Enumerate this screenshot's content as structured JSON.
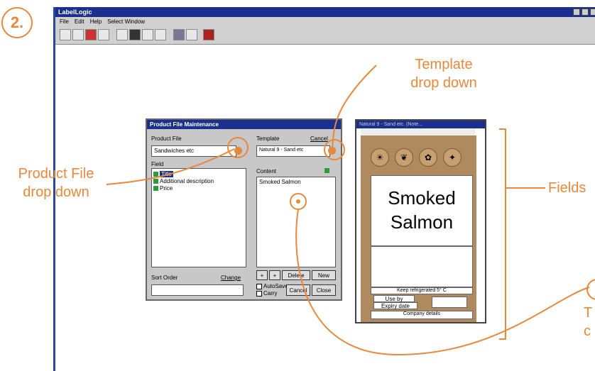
{
  "step_number": "2.",
  "app": {
    "title": "LabelLogic",
    "menu": [
      "File",
      "Edit",
      "Help",
      "Select Window"
    ]
  },
  "product_window": {
    "title": "Product File Maintenance",
    "product_file_label": "Product File",
    "product_file_value": "Sandwiches etc",
    "template_label": "Template",
    "template_value": "Natural 9 - Sand etc",
    "cancel_label": "Cancel",
    "field_label": "Field",
    "fields": [
      "Title",
      "Additional description",
      "Price"
    ],
    "content_label": "Content",
    "content_value": "Smoked Salmon",
    "sort_order_label": "Sort Order",
    "change_label": "Change",
    "plus_label": "+",
    "minus_label": "+",
    "delete_label": "Delete",
    "new_label": "New",
    "autosave_label": "AutoSave",
    "carry_label": "Carry",
    "cancel_btn_label": "Cancel",
    "close_btn_label": "Close"
  },
  "label_window": {
    "title": "Natural 9 - Sand etc. (Note...",
    "line1": "Smoked",
    "line2": "Salmon",
    "refrigerate": "Keep refrigerated 5° C",
    "use_by_1": "Use by",
    "use_by_2": "Expiry date",
    "company": "Company details"
  },
  "annotations": {
    "template_1": "Template",
    "template_2": "drop down",
    "product_1": "Product File",
    "product_2": "drop down",
    "fields": "Fields",
    "cut_1": "T",
    "cut_2": "c"
  }
}
